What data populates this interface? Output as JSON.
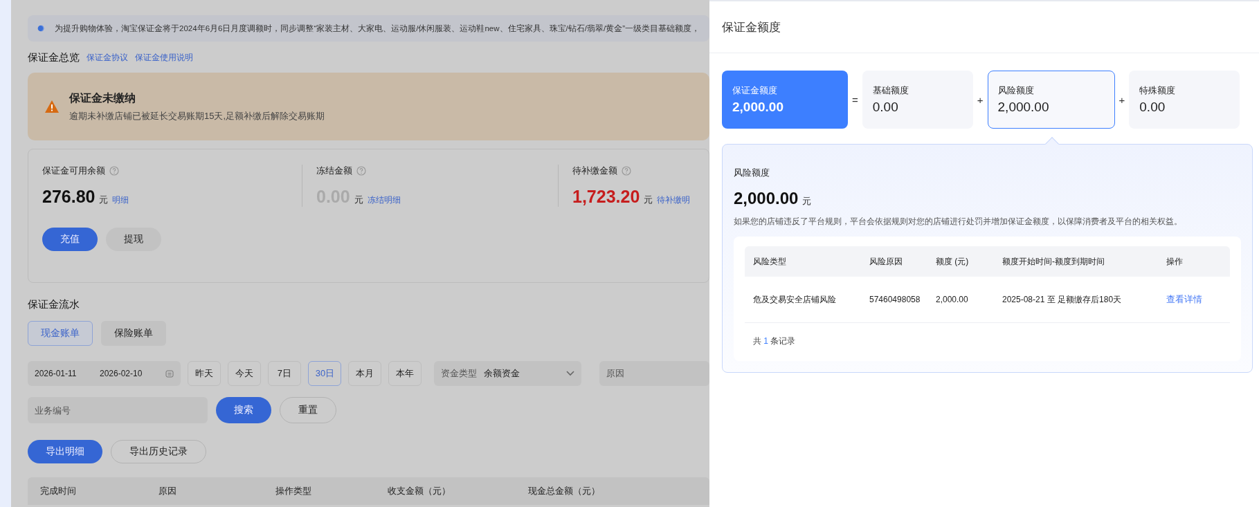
{
  "notice": {
    "text": "为提升购物体验，淘宝保证金将于2024年6月6日月度调额时，同步调整“家装主材、大家电、运动服/休闲服装、运动鞋new、住宅家具、珠宝/钻石/翡翠/黄金”一级类目基础额度，"
  },
  "overview": {
    "title": "保证金总览",
    "links": [
      "保证金协议",
      "保证金使用说明"
    ]
  },
  "alert": {
    "title": "保证金未缴纳",
    "message": "逾期未补缴店铺已被延长交易账期15天,足额补缴后解除交易账期"
  },
  "stats": [
    {
      "label": "保证金可用余额",
      "value": "276.80",
      "unit": "元",
      "link": "明细",
      "kind": "normal"
    },
    {
      "label": "冻结金额",
      "value": "0.00",
      "unit": "元",
      "link": "冻结明细",
      "kind": "muted"
    },
    {
      "label": "待补缴金额",
      "value": "1,723.20",
      "unit": "元",
      "link": "待补缴明",
      "kind": "alert"
    }
  ],
  "stat_buttons": [
    {
      "label": "充值",
      "kind": "primary"
    },
    {
      "label": "提现",
      "kind": "secondary"
    }
  ],
  "flow": {
    "title": "保证金流水",
    "tabs": [
      {
        "label": "现金账单",
        "selected": true
      },
      {
        "label": "保险账单",
        "selected": false
      }
    ]
  },
  "filters": {
    "date_start": "2026-01-11",
    "date_end": "2026-02-10",
    "ranges": [
      {
        "label": "昨天",
        "selected": false
      },
      {
        "label": "今天",
        "selected": false
      },
      {
        "label": "7日",
        "selected": false
      },
      {
        "label": "30日",
        "selected": true
      },
      {
        "label": "本月",
        "selected": false
      },
      {
        "label": "本年",
        "selected": false
      }
    ],
    "fund_type": {
      "label": "资金类型",
      "value": "余额资金"
    },
    "reason": {
      "label": "原因"
    },
    "business_no": {
      "placeholder": "业务编号"
    },
    "buttons": [
      {
        "label": "搜索",
        "kind": "primary"
      },
      {
        "label": "重置",
        "kind": "secondary"
      }
    ]
  },
  "exports": [
    {
      "label": "导出明细",
      "kind": "primary"
    },
    {
      "label": "导出历史记录",
      "kind": "secondary"
    }
  ],
  "flow_table": {
    "columns": [
      "完成时间",
      "原因",
      "操作类型",
      "收支金额（元）",
      "现金总金额（元）"
    ]
  },
  "drawer": {
    "title": "保证金额度",
    "quotas": [
      {
        "label": "保证金额度",
        "value": "2,000.00",
        "kind": "total",
        "selected": false
      },
      {
        "operator": "=",
        "label": "基础额度",
        "value": "0.00",
        "kind": "part",
        "selected": false
      },
      {
        "operator": "+",
        "label": "风险额度",
        "value": "2,000.00",
        "kind": "part",
        "selected": true
      },
      {
        "operator": "+",
        "label": "特殊额度",
        "value": "0.00",
        "kind": "part",
        "selected": false
      }
    ],
    "detail": {
      "title": "风险额度",
      "amount": "2,000.00",
      "unit": "元",
      "description": "如果您的店铺违反了平台规则，平台会依据规则对您的店铺进行处罚并增加保证金额度，以保障消费者及平台的相关权益。",
      "table": {
        "columns": [
          "风险类型",
          "风险原因",
          "额度 (元)",
          "额度开始时间-额度到期时间",
          "操作"
        ],
        "rows": [
          {
            "cells": [
              "危及交易安全店铺风险",
              "57460498058",
              "2,000.00",
              "2025-08-21 至 足额缴存后180天"
            ],
            "action": "查看详情"
          }
        ]
      },
      "footer": {
        "prefix": "共",
        "count": "1",
        "suffix": "条记录"
      }
    }
  }
}
